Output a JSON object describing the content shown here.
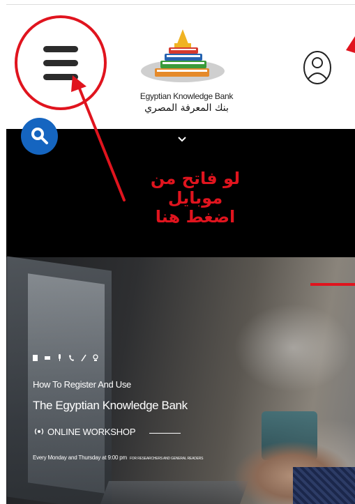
{
  "header": {
    "logo_en": "Egyptian Knowledge Bank",
    "logo_ar": "بنك المعرفة المصري"
  },
  "annotation": {
    "line1": "لو فاتح من موبايل",
    "line2": "اضغط هنا",
    "color": "#e0141e"
  },
  "hero": {
    "subtitle": "How To Register And Use",
    "title": "The Egyptian Knowledge Bank",
    "workshop_label": "ONLINE WORKSHOP",
    "schedule": "Every Monday and Thursday at 9:00 pm",
    "audience": "FOR RESEARCHERS AND GENERAL READERS"
  },
  "icons": {
    "menu": "hamburger-icon",
    "user": "user-icon",
    "search": "search-icon",
    "chevron": "chevron-down-icon",
    "broadcast": "broadcast-icon"
  },
  "colors": {
    "accent_blue": "#1565c0",
    "annotation_red": "#e0141e"
  }
}
